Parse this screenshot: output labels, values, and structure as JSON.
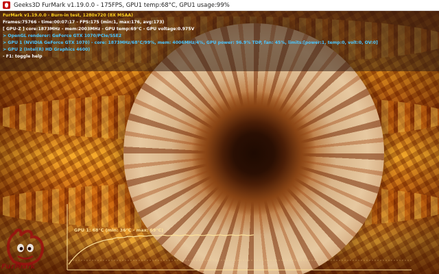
{
  "window": {
    "title": "Geeks3D FurMark v1.19.0.0 - 175FPS, GPU1 temp:68°C, GPU1 usage:99%"
  },
  "overlay": {
    "lines": [
      {
        "text": "FurMark v1.19.0.0 - Burn-in test, 1280x720 (8X MSAA)",
        "color": "#ffd21f"
      },
      {
        "text": "Frames:75766 - time:00:07:17 - FPS:175 (min:1, max:176, avg:173)",
        "color": "#ffffff"
      },
      {
        "text": "[ GPU-Z ] core:1873MHz - mem:2003MHz - GPU temp:69°C - GPU voltage:0.975V",
        "color": "#ffffff"
      },
      {
        "text": "> OpenGL renderer: GeForce GTX 1070/PCIe/SSE2",
        "color": "#4cc6ff"
      },
      {
        "text": "> GPU 1 (NVIDIA GeForce GTX 1070) - core: 1873MHz/68°C/99%, mem: 4006MHz/4%, GPU power: 96.9% TDP, fan: 45%, limits:[power:1, temp:0, volt:0, OV:0]",
        "color": "#4cc6ff"
      },
      {
        "text": "> GPU 2 (Intel(R) HD Graphics 4600)",
        "color": "#4cc6ff"
      },
      {
        "text": "- F1: toggle help",
        "color": "#ffffff"
      }
    ]
  },
  "graph": {
    "label": "GPU 1: 68°C (min: 36°C - max: 69°C)",
    "min_temp": 36,
    "max_temp": 69,
    "current_temp": 68,
    "line_color": "#ffe39a"
  },
  "logo": {
    "text": "FurMark",
    "color": "#8c0f0f"
  },
  "icons": {
    "app": "furmark-app-icon"
  }
}
